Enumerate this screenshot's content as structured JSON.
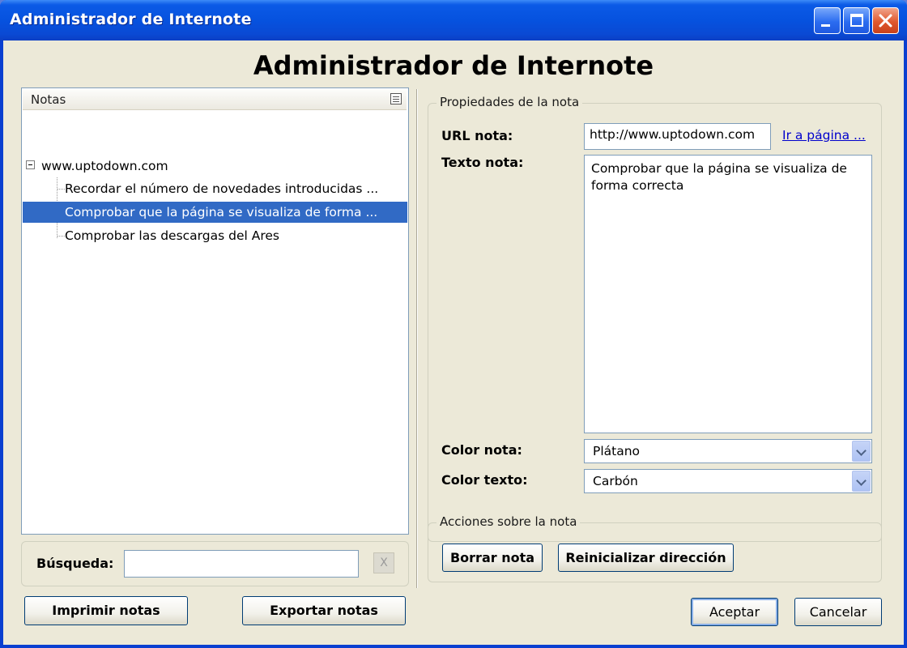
{
  "window": {
    "title": "Administrador de Internote",
    "heading": "Administrador de Internote"
  },
  "notes_panel": {
    "column_header": "Notas",
    "tree": {
      "root": "www.uptodown.com",
      "items": [
        {
          "label": "Recordar el número de novedades introducidas ...",
          "selected": false
        },
        {
          "label": "Comprobar que la página se visualiza de forma ...",
          "selected": true
        },
        {
          "label": "Comprobar las descargas del Ares",
          "selected": false
        }
      ]
    },
    "search": {
      "label": "Búsqueda:",
      "value": "",
      "clear_label": "X"
    },
    "print_button": "Imprimir notas",
    "export_button": "Exportar notas"
  },
  "properties": {
    "group_title": "Propiedades de la nota",
    "url_label": "URL nota:",
    "url_value": "http://www.uptodown.com",
    "go_link": "Ir a página ...",
    "text_label": "Texto nota:",
    "text_value": "Comprobar que la página se visualiza de forma correcta",
    "note_color_label": "Color nota:",
    "note_color_value": "Plátano",
    "text_color_label": "Color texto:",
    "text_color_value": "Carbón"
  },
  "actions": {
    "group_title": "Acciones sobre la nota",
    "delete_button": "Borrar nota",
    "reset_button": "Reinicializar dirección"
  },
  "footer": {
    "accept_button": "Aceptar",
    "cancel_button": "Cancelar"
  },
  "colors": {
    "titlebar": "#0a49d3",
    "window_bg": "#ece9d8",
    "selection": "#316ac5"
  }
}
